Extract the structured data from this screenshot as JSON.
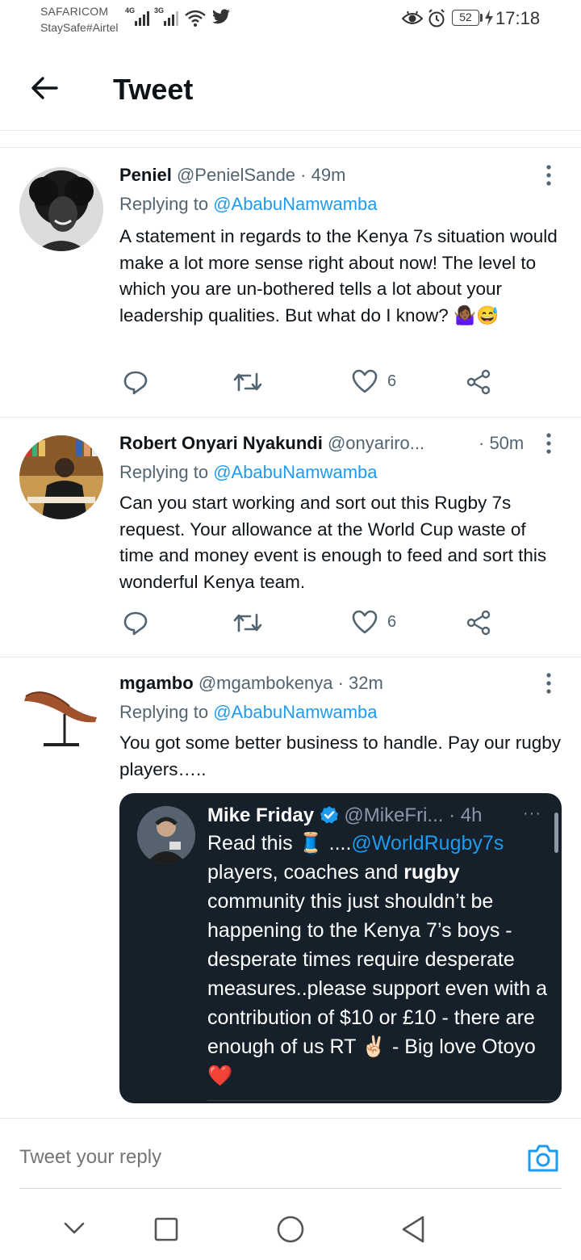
{
  "status_bar": {
    "carrier_primary": "SAFARICOM",
    "carrier_secondary": "StaySafe#Airtel",
    "signal1_type": "4G",
    "signal2_type": "3G",
    "battery": "52",
    "time": "17:18"
  },
  "header": {
    "title": "Tweet"
  },
  "tweets": [
    {
      "name": "Peniel",
      "handle": "@PenielSande",
      "time": "· 49m",
      "replying_prefix": "Replying to ",
      "replying_handle": "@AbabuNamwamba",
      "text": "A statement in regards to the Kenya 7s situation would make a lot more sense right about now! The level to which you are un-bothered tells a lot about your leadership qualities. But what do I know? 🤷🏾‍♀️😅",
      "likes": "6"
    },
    {
      "name": "Robert Onyari Nyakundi",
      "handle": "@onyariro...",
      "time": "· 50m",
      "replying_prefix": "Replying to ",
      "replying_handle": "@AbabuNamwamba",
      "text": "Can you start working and sort out this Rugby 7s request. Your allowance at the World Cup waste of time and money event is enough to feed and sort this wonderful Kenya team.",
      "likes": "6"
    },
    {
      "name": "mgambo",
      "handle": "@mgambokenya",
      "time": "· 32m",
      "replying_prefix": "Replying to ",
      "replying_handle": "@AbabuNamwamba",
      "text": "You got some better business to handle. Pay our rugby players….."
    }
  ],
  "quoted": {
    "name": "Mike Friday",
    "handle": "@MikeFri...",
    "time": "· 4h",
    "more": "···",
    "text_start": "Read this 🧵 ....",
    "mention": "@WorldRugby7s",
    "text_mid": " players, coaches and ",
    "bold_word": "rugby",
    "text_end": " community this just shouldn’t be happening to the Kenya 7’s boys - desperate times require desperate measures..please support even with a contribution of $10 or £10 - there are enough of us RT ✌🏻 - Big love Otoyo❤️"
  },
  "reply_bar": {
    "placeholder": "Tweet your reply"
  },
  "colors": {
    "accent": "#1d9bf0",
    "quote_bg": "#15202b",
    "muted": "#536471"
  }
}
